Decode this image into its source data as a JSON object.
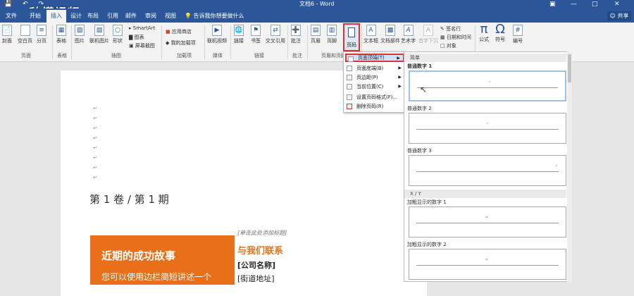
{
  "titlebar": {
    "title": "文档6 - Word",
    "watermark": "秒懂视频"
  },
  "tabs": [
    "文件",
    "开始",
    "插入",
    "设计",
    "布局",
    "引用",
    "邮件",
    "审阅",
    "视图"
  ],
  "tellme": "告诉我你想要做什么",
  "share": "共享",
  "ribbon": {
    "pages": {
      "items": [
        "封面",
        "空白页",
        "分页"
      ],
      "label": "页面"
    },
    "tables": {
      "items": [
        "表格"
      ],
      "label": "表格"
    },
    "illustrations": {
      "items": [
        "图片",
        "联机图片",
        "形状"
      ],
      "small": [
        "SmartArt",
        "图表",
        "屏幕截图"
      ],
      "label": "插图"
    },
    "addins": {
      "small": [
        "应用商店",
        "我的加载项"
      ],
      "label": "加载项"
    },
    "media": {
      "items": [
        "联机视频"
      ],
      "label": "媒体"
    },
    "links": {
      "items": [
        "链接",
        "书签",
        "交叉引用"
      ],
      "label": "链接"
    },
    "comments": {
      "items": [
        "批注"
      ],
      "label": "批注"
    },
    "headerfooter": {
      "items": [
        "页眉",
        "页脚",
        "页码"
      ],
      "label": "页眉和页脚"
    },
    "text": {
      "items": [
        "文本框",
        "文档部件",
        "艺术字",
        "首字下沉"
      ],
      "small": [
        "签名行",
        "日期和时间",
        "对象"
      ],
      "label": "文本"
    },
    "symbols": {
      "items": [
        "公式",
        "符号",
        "编号"
      ],
      "label": "符号"
    }
  },
  "menu": {
    "items": [
      "页面顶端(T)",
      "页面底端(B)",
      "页边距(P)",
      "当前位置(C)",
      "设置页码格式(F)...",
      "删除页码(R)"
    ]
  },
  "gallery": {
    "header_simple": "简单",
    "items": [
      {
        "label": "普通数字 1",
        "align": "center"
      },
      {
        "label": "普通数字 2",
        "align": "center"
      },
      {
        "label": "普通数字 3",
        "align": "right"
      }
    ],
    "header_xy": "X / Y",
    "bold_items": [
      {
        "label": "加粗显示的数字 1"
      },
      {
        "label": "加粗显示的数字 2"
      }
    ]
  },
  "document": {
    "volume": "第 1 卷 / 第 1 期",
    "story_title": "近期的成功故事",
    "story_text": "您可以使用边栏简短讲述一个",
    "heading_placeholder": "[单击此处添加标题]",
    "contact_title": "与我们联系",
    "company": "[公司名称]",
    "street": "[街道地址]"
  },
  "colors": {
    "brand_blue": "#2b579a",
    "accent_orange": "#e8701a",
    "highlight_red": "#d33333"
  }
}
